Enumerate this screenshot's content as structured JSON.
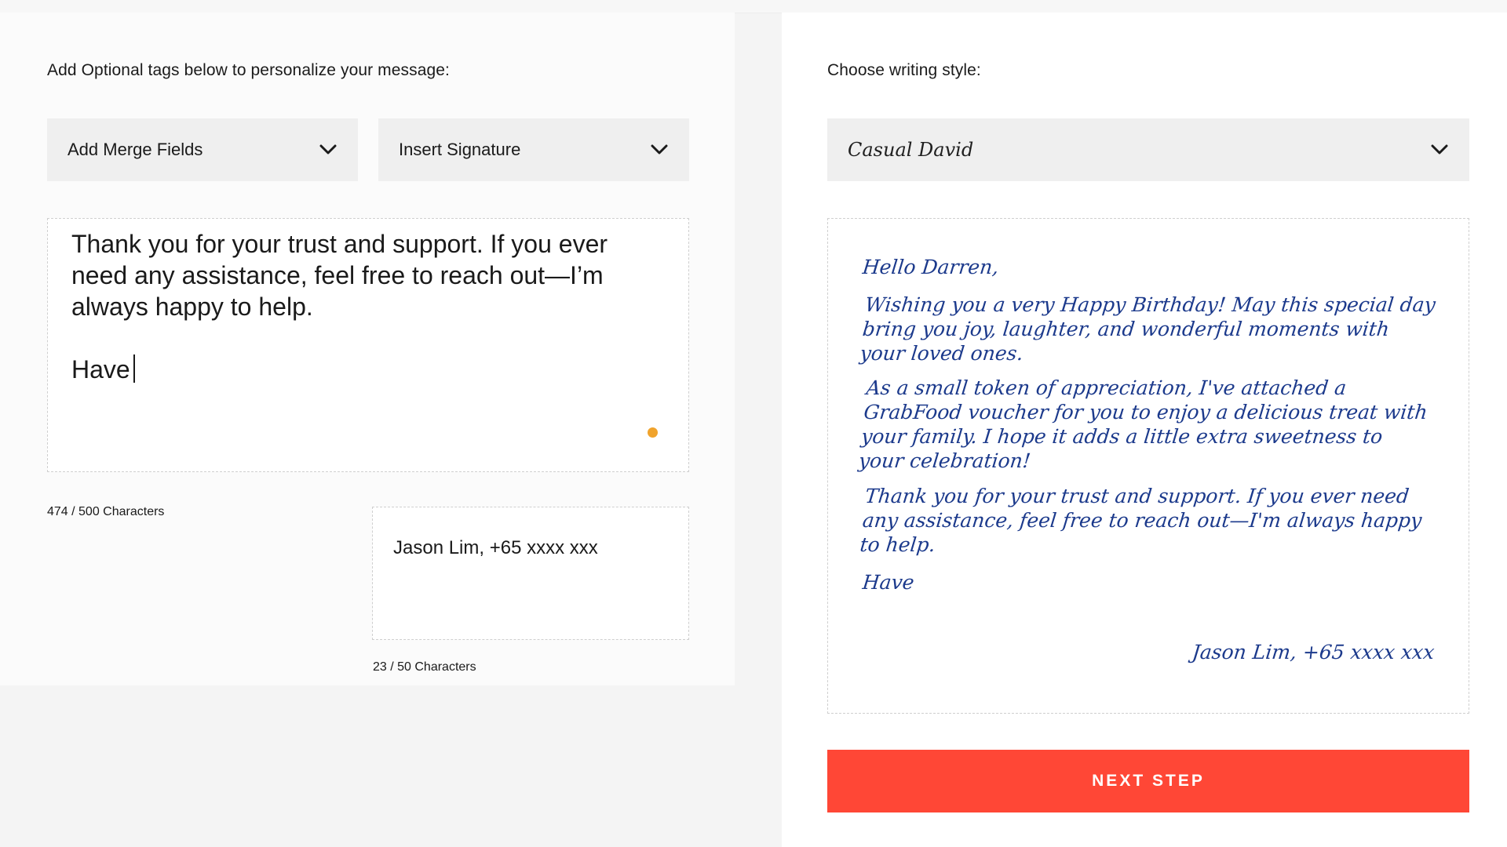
{
  "left": {
    "tags_label": "Add Optional tags below to personalize your message:",
    "merge_fields_label": "Add Merge Fields",
    "insert_signature_label": "Insert Signature",
    "message_text": "Thank you for your trust and support. If you ever need any assistance, feel free to reach out—I’m always happy to help.\n\nHave",
    "message_counter": "474 / 500 Characters",
    "signature_text": "Jason Lim, +65 xxxx xxx",
    "signature_counter": "23 / 50 Characters",
    "status_dot_color": "#f0a32c"
  },
  "right": {
    "style_label": "Choose writing style:",
    "style_value": "Casual David",
    "preview": {
      "greeting": "Hello Darren,",
      "para1": "Wishing you a very Happy Birthday! May this special day bring you joy, laughter, and wonderful moments with your loved ones.",
      "para2": "As a small token of appreciation, I've attached a GrabFood voucher for you to enjoy a delicious treat with your family. I hope it adds a little extra sweetness to your celebration!",
      "para3": "Thank you for your trust and support. If you ever need any assistance, feel free to reach out—I'm always happy to help.",
      "para4": "Have",
      "signature": "Jason Lim, +65 xxxx xxx",
      "ink_color": "#1c3a8c"
    },
    "next_button_label": "NEXT STEP",
    "next_button_color": "#ff4736"
  },
  "icons": {
    "dropdown_arrow": "chevron-down-icon"
  }
}
